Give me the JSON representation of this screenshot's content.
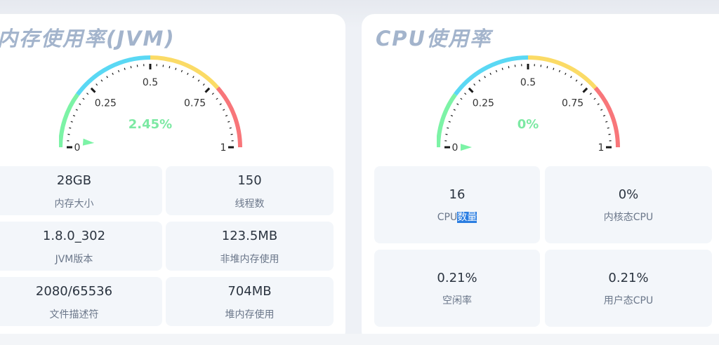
{
  "colors": {
    "green": "#7cf3a6",
    "cyan": "#5ad8f4",
    "yellow": "#fbdb66",
    "red": "#f8767a",
    "value_text": "#7ce9a3",
    "title": "#a3b4cc"
  },
  "jvm": {
    "title": "内存使用率(JVM)",
    "gauge": {
      "value_text": "2.45%",
      "value": 0.0245,
      "tick_labels": [
        "0",
        "0.25",
        "0.5",
        "0.75",
        "1"
      ]
    },
    "stats": [
      {
        "value": "28GB",
        "label": "内存大小"
      },
      {
        "value": "150",
        "label": "线程数"
      },
      {
        "value": "1.8.0_302",
        "label": "JVM版本"
      },
      {
        "value": "123.5MB",
        "label": "非堆内存使用"
      },
      {
        "value": "2080/65536",
        "label": "文件描述符"
      },
      {
        "value": "704MB",
        "label": "堆内存使用"
      }
    ]
  },
  "cpu": {
    "title": "CPU使用率",
    "gauge": {
      "value_text": "0%",
      "value": 0,
      "tick_labels": [
        "0",
        "0.25",
        "0.5",
        "0.75",
        "1"
      ]
    },
    "stats": [
      {
        "value": "16",
        "label_prefix": "CPU",
        "label_highlight": "数量"
      },
      {
        "value": "0%",
        "label": "内核态CPU"
      },
      {
        "value": "0.21%",
        "label": "空闲率"
      },
      {
        "value": "0.21%",
        "label": "用户态CPU"
      }
    ]
  }
}
